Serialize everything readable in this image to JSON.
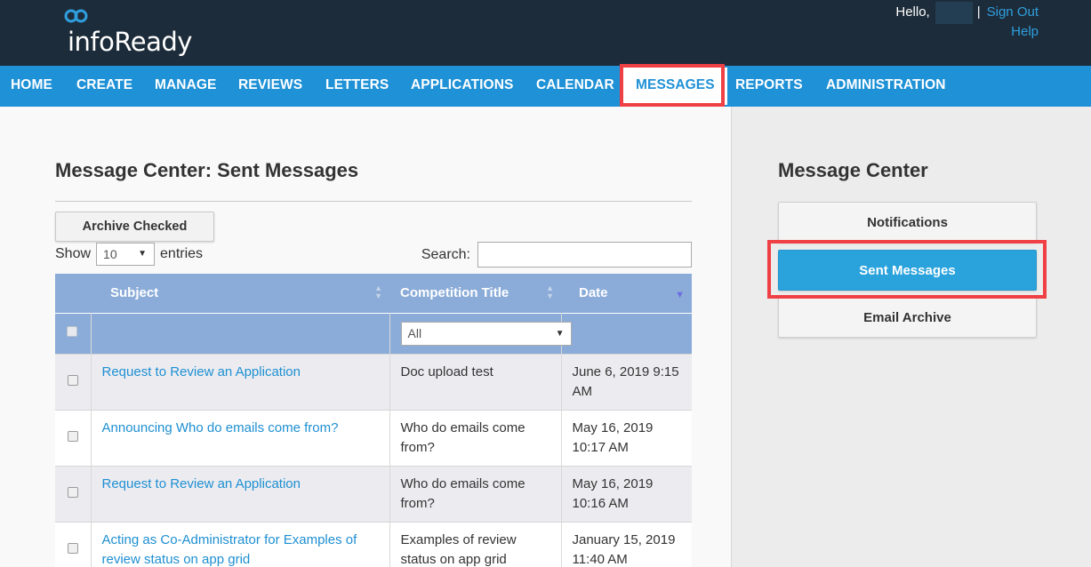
{
  "brand": {
    "name": "infoReady"
  },
  "user_menu": {
    "greeting": "Hello,",
    "separator": "|",
    "sign_out": "Sign Out",
    "help": "Help"
  },
  "nav": {
    "items": [
      {
        "label": "HOME"
      },
      {
        "label": "CREATE"
      },
      {
        "label": "MANAGE"
      },
      {
        "label": "REVIEWS"
      },
      {
        "label": "LETTERS"
      },
      {
        "label": "APPLICATIONS"
      },
      {
        "label": "CALENDAR"
      },
      {
        "label": "MESSAGES",
        "active": true
      },
      {
        "label": "REPORTS"
      },
      {
        "label": "ADMINISTRATION"
      }
    ]
  },
  "main": {
    "title": "Message Center: Sent Messages",
    "archive_button": "Archive Checked",
    "show_label": "Show",
    "entries_value": "10",
    "entries_label": "entries",
    "search_label": "Search:",
    "search_value": ""
  },
  "table": {
    "columns": [
      "Subject",
      "Competition Title",
      "Date"
    ],
    "sorted_column": "Date",
    "competition_filter": "All",
    "rows": [
      {
        "subject": "Request to Review an Application",
        "competition": "Doc upload test",
        "date": "June 6, 2019 9:15 AM"
      },
      {
        "subject": "Announcing Who do emails come from?",
        "competition": "Who do emails come from?",
        "date": "May 16, 2019 10:17 AM"
      },
      {
        "subject": "Request to Review an Application",
        "competition": "Who do emails come from?",
        "date": "May 16, 2019 10:16 AM"
      },
      {
        "subject": "Acting as Co-Administrator for Examples of review status on app grid",
        "competition": "Examples of review status on app grid",
        "date": "January 15, 2019 11:40 AM"
      }
    ]
  },
  "sidebar": {
    "title": "Message Center",
    "buttons": [
      {
        "label": "Notifications"
      },
      {
        "label": "Sent Messages",
        "active": true
      },
      {
        "label": "Email Archive"
      }
    ]
  },
  "colors": {
    "header_bg": "#1d2c3a",
    "nav_bg": "#1f91d6",
    "link": "#1e8fd2",
    "table_header": "#8bacd8",
    "highlight": "#ef4045",
    "active_button": "#2aa3dd"
  }
}
